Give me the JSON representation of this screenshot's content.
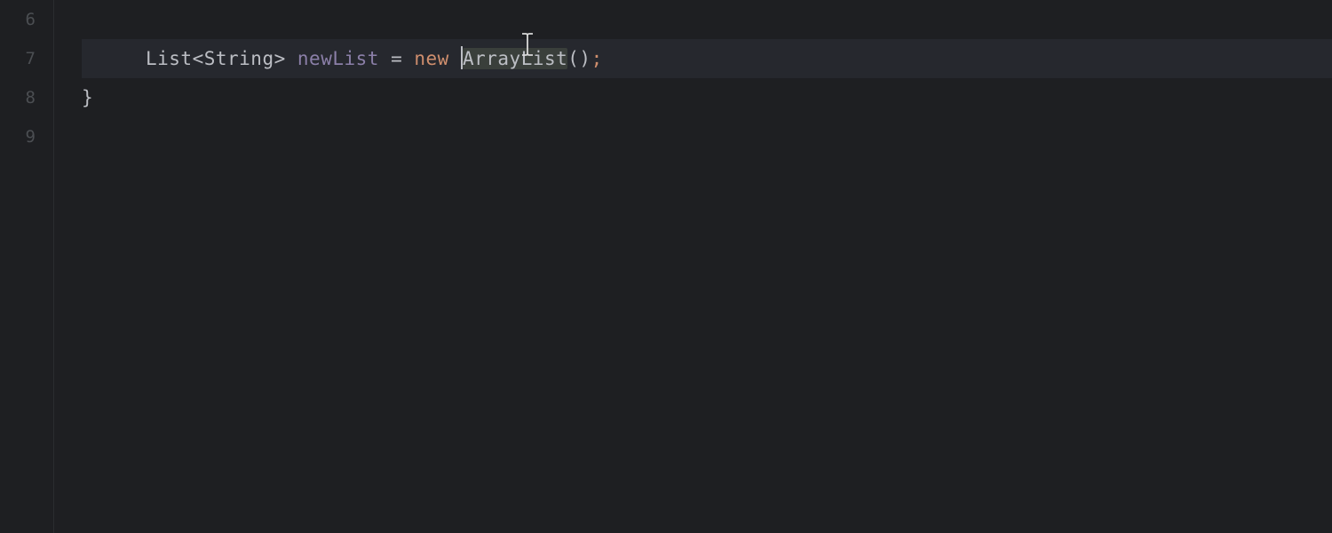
{
  "editor": {
    "gutter": {
      "lines": [
        "6",
        "7",
        "8",
        "9"
      ]
    },
    "code": {
      "line6": "",
      "line7": {
        "indent": "    ",
        "type1": "List",
        "generic_open": "<",
        "generic_type": "String",
        "generic_close": ">",
        "space1": " ",
        "varname": "newList",
        "space2": " ",
        "assign": "=",
        "space3": " ",
        "keyword_new": "new",
        "space4": " ",
        "classname": "ArrayList",
        "parens": "()",
        "semi": ";"
      },
      "line8": {
        "brace": "}"
      },
      "line9": ""
    }
  },
  "colors": {
    "background": "#1e1f22",
    "gutter_text": "#4b4e52",
    "active_line": "#26282e",
    "keyword": "#cf8e6d",
    "variable": "#8b7fa8",
    "text": "#bcbec4"
  }
}
